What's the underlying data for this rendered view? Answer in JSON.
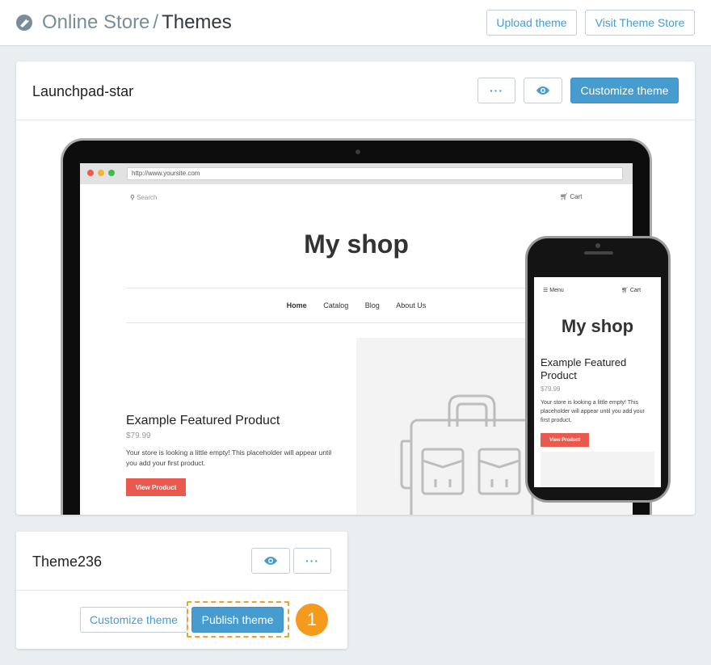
{
  "header": {
    "breadcrumb_parent": "Online Store",
    "breadcrumb_separator": "/",
    "breadcrumb_current": "Themes",
    "upload_label": "Upload theme",
    "visit_store_label": "Visit Theme Store"
  },
  "current_theme": {
    "name": "Launchpad-star",
    "more_label": "···",
    "customize_label": "Customize theme"
  },
  "preview": {
    "url": "http://www.yoursite.com",
    "search": "Search",
    "cart": "Cart",
    "shop_title": "My shop",
    "nav": [
      "Home",
      "Catalog",
      "Blog",
      "About Us"
    ],
    "product_title": "Example Featured Product",
    "price": "$79.99",
    "description": "Your store is looking a little empty! This placeholder will appear until you add your first product.",
    "view_button": "View Product"
  },
  "mobile_preview": {
    "menu": "Menu",
    "cart": "Cart",
    "shop_title": "My shop",
    "product_title": "Example Featured Product",
    "price": "$79.99",
    "description": "Your store is looking a little empty! This placeholder will appear until you add your first product.",
    "view_button": "View Product"
  },
  "other_theme": {
    "name": "Theme236",
    "more_label": "···",
    "customize_label": "Customize theme",
    "publish_label": "Publish theme"
  },
  "step_marker": "1",
  "colors": {
    "accent": "#479ccf",
    "step_badge": "#f49a1c",
    "product_button": "#e9594e"
  }
}
